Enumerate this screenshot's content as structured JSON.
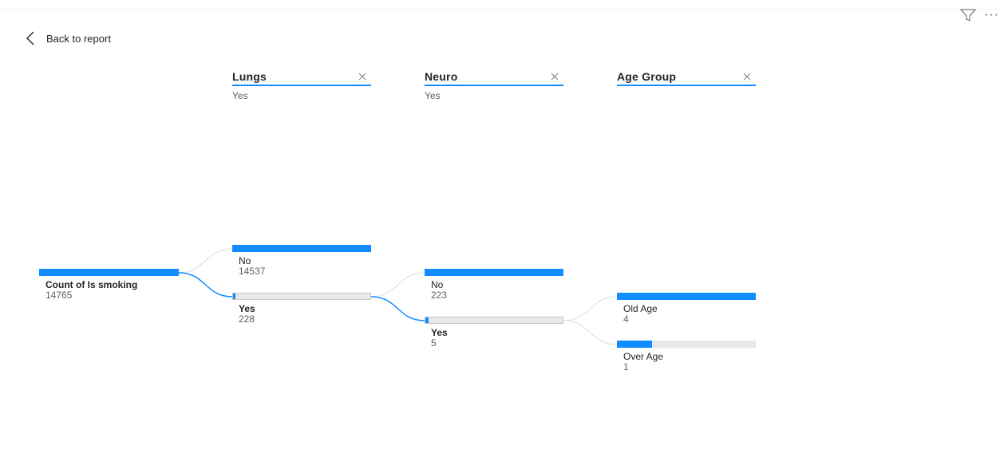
{
  "toolbar": {
    "back_label": "Back to report",
    "filter_icon": "filter-icon",
    "more_icon": "more-options-icon",
    "more_glyph": "···"
  },
  "levels": [
    {
      "title": "Lungs",
      "selected": "Yes"
    },
    {
      "title": "Neuro",
      "selected": "Yes"
    },
    {
      "title": "Age Group",
      "selected": ""
    }
  ],
  "root": {
    "label": "Count of Is smoking",
    "value": "14765"
  },
  "lungs": [
    {
      "label": "No",
      "value": "14537",
      "fraction": 1.0,
      "selected": false
    },
    {
      "label": "Yes",
      "value": "228",
      "fraction": 0.016,
      "selected": true
    }
  ],
  "neuro": [
    {
      "label": "No",
      "value": "223",
      "fraction": 1.0,
      "selected": false
    },
    {
      "label": "Yes",
      "value": "5",
      "fraction": 0.022,
      "selected": true
    }
  ],
  "age": [
    {
      "label": "Old Age",
      "value": "4",
      "fraction": 1.0,
      "selected": false
    },
    {
      "label": "Over Age",
      "value": "1",
      "fraction": 0.25,
      "selected": false
    }
  ],
  "colors": {
    "accent": "#118dff",
    "track": "#e8e8e8",
    "link_muted": "#e6e6e6"
  }
}
